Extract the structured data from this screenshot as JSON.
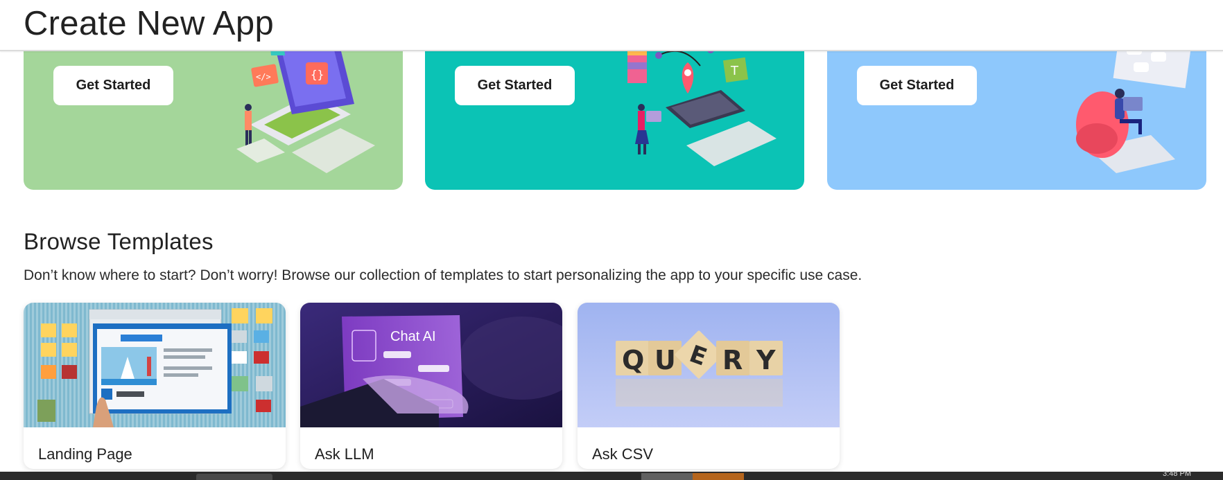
{
  "header": {
    "title": "Create New App"
  },
  "hero_cards": [
    {
      "button_label": "Get Started",
      "color": "#a4d69a",
      "illustration": "laptop-code-illustration"
    },
    {
      "button_label": "Get Started",
      "color": "#0bc3b5",
      "illustration": "design-tools-illustration"
    },
    {
      "button_label": "Get Started",
      "color": "#8ec8fc",
      "illustration": "chat-bubbles-illustration"
    }
  ],
  "templates_section": {
    "title": "Browse Templates",
    "description": "Don’t know where to start? Don’t worry! Browse our collection of templates to start personalizing the app to your specific use case.",
    "items": [
      {
        "label": "Landing Page",
        "thumb": "landing-page-thumbnail"
      },
      {
        "label": "Ask LLM",
        "thumb": "chat-ai-thumbnail",
        "thumb_text": "Chat AI"
      },
      {
        "label": "Ask CSV",
        "thumb": "query-blocks-thumbnail",
        "thumb_letters": [
          "Q",
          "U",
          "E",
          "R",
          "Y"
        ]
      }
    ]
  },
  "taskbar": {
    "clock": "3:48 PM"
  }
}
